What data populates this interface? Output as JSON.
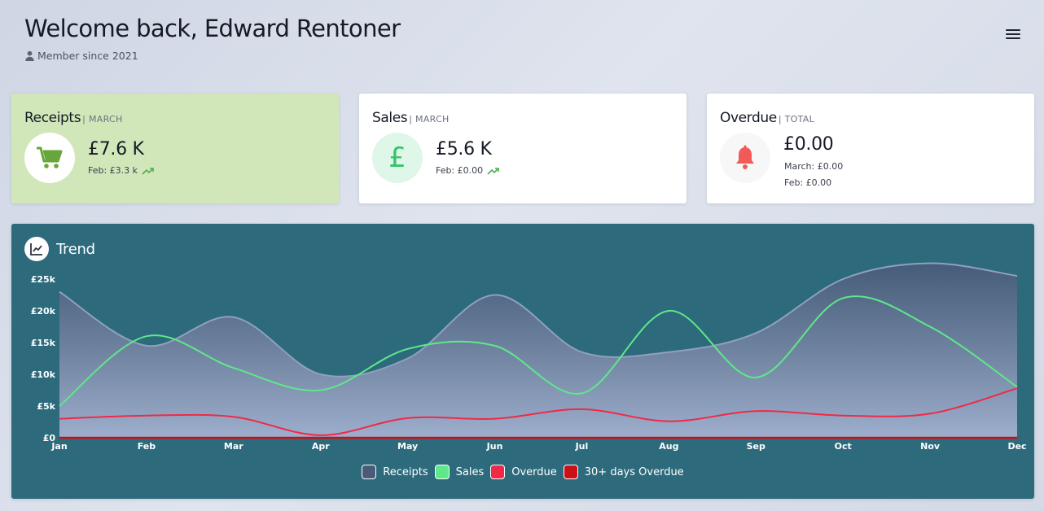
{
  "header": {
    "welcome": "Welcome back, Edward Rentoner",
    "member_since": "Member since 2021",
    "icons": {
      "member": "user-icon",
      "menu": "hamburger-menu-icon"
    }
  },
  "cards": {
    "receipts": {
      "title": "Receipts",
      "period": "| MARCH",
      "amount": "£7.6 K",
      "prev": "Feb: £3.3 k",
      "icon": "shopping-cart-icon",
      "bg": "#d2e7b9"
    },
    "sales": {
      "title": "Sales",
      "period": "| MARCH",
      "amount": "£5.6 K",
      "prev": "Feb: £0.00",
      "icon": "pound-icon",
      "symbol": "£"
    },
    "overdue": {
      "title": "Overdue",
      "period": "| TOTAL",
      "amount": "£0.00",
      "prev_march": "March: £0.00",
      "prev_feb": "Feb: £0.00",
      "icon": "bell-icon"
    }
  },
  "chart_data": {
    "type": "line",
    "title": "Trend",
    "categories": [
      "Jan",
      "Feb",
      "Mar",
      "Apr",
      "May",
      "Jun",
      "Jul",
      "Aug",
      "Sep",
      "Oct",
      "Nov",
      "Dec"
    ],
    "y_tick_labels": [
      "£0",
      "£5k",
      "£10k",
      "£15k",
      "£20k",
      "£25k"
    ],
    "ylim": [
      0,
      25000
    ],
    "legend_position": "bottom",
    "series": [
      {
        "name": "Receipts",
        "color": "#8fa0bf",
        "fill": true,
        "values": [
          23000,
          14500,
          19000,
          10000,
          12500,
          22500,
          13500,
          13500,
          16500,
          25000,
          27500,
          25500
        ]
      },
      {
        "name": "Sales",
        "color": "#5ee88a",
        "fill": false,
        "values": [
          5000,
          16000,
          11000,
          7500,
          14000,
          14500,
          7000,
          20000,
          9500,
          22000,
          17500,
          8000
        ]
      },
      {
        "name": "Overdue",
        "color": "#ee2a48",
        "fill": false,
        "values": [
          3000,
          3500,
          3300,
          400,
          3100,
          3000,
          4500,
          2600,
          4200,
          3500,
          3800,
          7800
        ]
      },
      {
        "name": "30+ days Overdue",
        "color": "#cc1018",
        "fill": false,
        "values": [
          0,
          0,
          0,
          0,
          0,
          0,
          0,
          0,
          0,
          0,
          0,
          0
        ]
      }
    ]
  }
}
